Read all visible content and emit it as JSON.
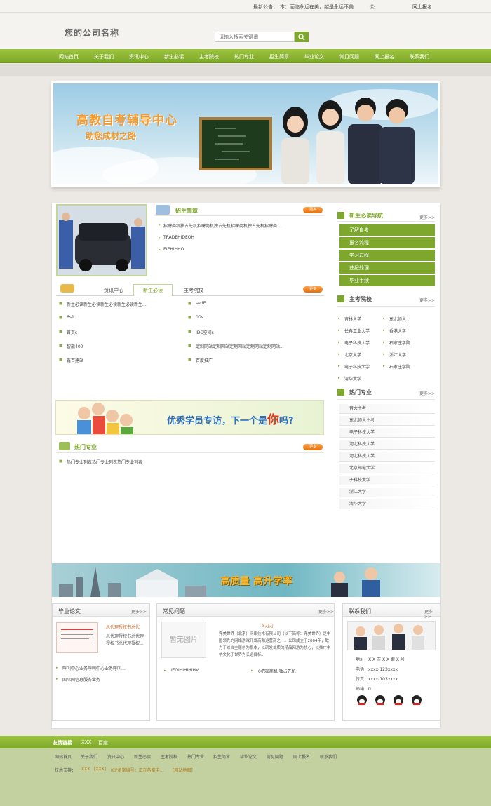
{
  "topbar": {
    "notice_label": "最新公告：",
    "notice_text": "本：而临永远在美，越是永远不美",
    "mark": "公",
    "online_apply": "网上报名"
  },
  "header": {
    "logo": "您的公司名称",
    "search_placeholder": "请输入搜索关键词"
  },
  "nav": [
    "网站首页",
    "关于我们",
    "资讯中心",
    "新生必读",
    "主考院校",
    "热门专业",
    "招生简章",
    "毕业论文",
    "常见问题",
    "网上报名",
    "联系我们"
  ],
  "banner": {
    "title": "高教自考辅导中心",
    "subtitle": "助您成材之路"
  },
  "admission": {
    "title": "招生简章",
    "more": "更多",
    "items": [
      "招聘商机独占先机招聘商机独占先机招聘商机独占先机招聘商...",
      "TRADEHIDEOH",
      "EIEHIHHO"
    ]
  },
  "tabs": {
    "labels": [
      "资讯中心",
      "新生必读",
      "主考院校"
    ],
    "more": "更多",
    "left": [
      "新生必读新生必读新生必读新生必读新生...",
      "6s1",
      "首页s",
      "智能400",
      "鑫百建站"
    ],
    "right": [
      "sedE",
      "00s",
      "IDC空间s",
      "定制网站定制网站定制网站定制网站定制网站...",
      "百度推广"
    ]
  },
  "mid_banner": {
    "text": "优秀学员专访，下一个是",
    "emph": "你",
    "tail": "吗?"
  },
  "hot_major": {
    "title": "热门专业",
    "more": "更多",
    "items": [
      "热门专业列表热门专业列表热门专业列表"
    ]
  },
  "freshman_nav": {
    "title": "新生必读导航",
    "more": "更多>>",
    "items": [
      "了解自考",
      "报名流程",
      "学习过程",
      "违纪处理",
      "毕业手续"
    ]
  },
  "schools": {
    "title": "主考院校",
    "more": "更多>>",
    "items": [
      "吉林大学",
      "东北师大",
      "长春工业大学",
      "香港大学",
      "电子科技大学",
      "石家庄学院",
      "北京大学",
      "浙江大学",
      "电子科技大学",
      "石家庄学院",
      "清华大学"
    ]
  },
  "majors": {
    "title": "热门专业",
    "more": "更多>>",
    "items": [
      "音大主考",
      "东北师大主考",
      "电子科技大学",
      "河北科技大学",
      "河北科技大学",
      "北京邮电大学",
      "子科技大学",
      "浙江大学",
      "清华大学"
    ]
  },
  "bottom_banner": {
    "text": "高质量 高升学率"
  },
  "thesis": {
    "title": "毕业论文",
    "more": "更多>>",
    "featured": "总代理授权书总代",
    "desc": "总代理授权书总代理授权书总代理授权...",
    "items": [
      "呼叫中心业务呼叫中心业务呼叫...",
      "国际网信息服务业务"
    ]
  },
  "faq": {
    "title": "常见问题",
    "more": "更多>>",
    "no_image": "暂无图片",
    "heading": "S刀刀",
    "desc": "完美世界（北京）网络技术有限公司（以下简称：完美世界）是中国领先的网络游戏开发商和运营商之一。公司成立于2004年，致力于以自主原创为根本，以研发优质的精品网游为核心，以推广中华文化于世界为长远目标。",
    "items": [
      "IFOIHIHIHIHV",
      "0把握商机 独占先机"
    ]
  },
  "contact": {
    "title": "联系我们",
    "more": "更多>>",
    "address": "地址：X X 市 X X 街 X 号",
    "phone": "电话：xxxx-123xxxx",
    "fax": "传真：xxxx-103xxxx",
    "email": "邮箱：0"
  },
  "footer": {
    "links_label": "友情链接",
    "friend_links": [
      "XXX",
      "百度"
    ],
    "nav": [
      "网站首页",
      "关于我们",
      "资讯中心",
      "新生必读",
      "主考院校",
      "热门专业",
      "招生简章",
      "毕业论文",
      "常见问题",
      "网上报名",
      "联系我们"
    ],
    "support": "技术支持：",
    "support_items": [
      "XXX",
      "[XXX]",
      "ICP备案编号：正在备案中...",
      "[网站地图]"
    ]
  },
  "colors": {
    "accent": "#7ea82d",
    "orange": "#f08a24"
  }
}
